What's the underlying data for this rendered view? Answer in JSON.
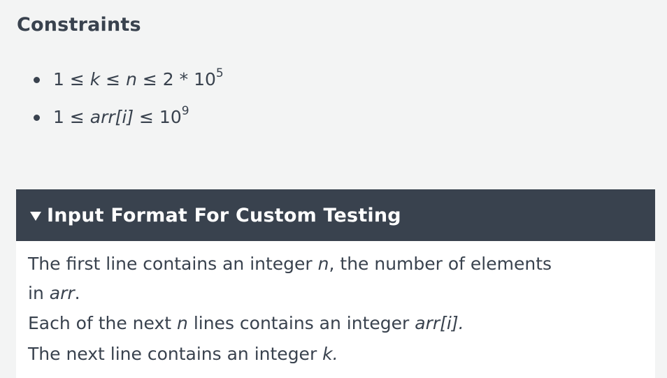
{
  "constraints": {
    "title": "Constraints",
    "items": [
      {
        "prefix": "1 ≤ ",
        "italic": "k",
        "mid1": " ≤ ",
        "italic2": "n",
        "suffix": " ≤ 2 * 10",
        "sup": "5"
      },
      {
        "prefix": "1 ≤ ",
        "italic": "arr[i]",
        "suffix": " ≤ 10",
        "sup": "9"
      }
    ]
  },
  "input_format": {
    "header": "Input Format For Custom Testing",
    "line1_a": "The first line contains an integer ",
    "line1_n": "n",
    "line1_b": ", the number of elements",
    "line1_c": "in ",
    "line1_arr": "arr",
    "line1_d": ".",
    "line2_a": "Each of the next ",
    "line2_n": "n",
    "line2_b": " lines contains an integer ",
    "line2_arr": "arr[i].",
    "line3_a": "The next line contains an integer ",
    "line3_k": "k."
  }
}
